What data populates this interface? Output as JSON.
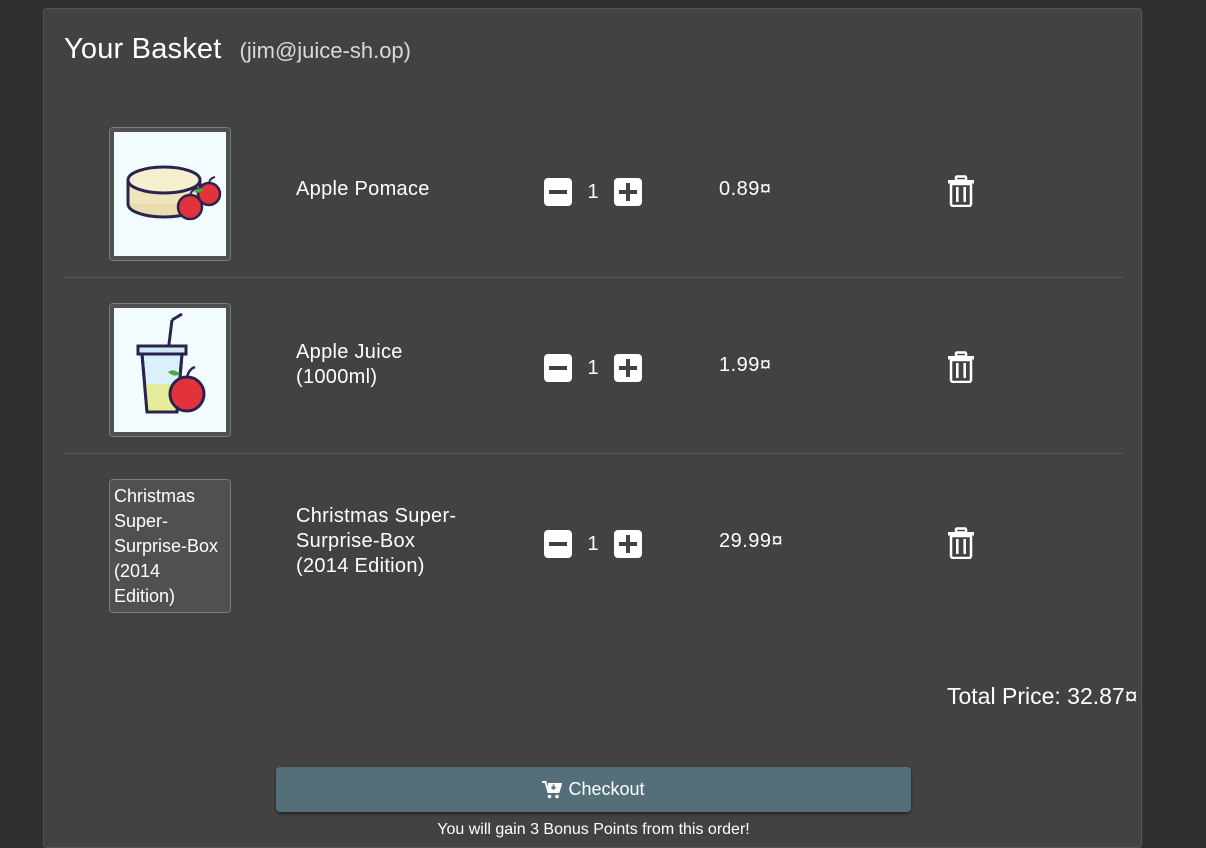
{
  "basket": {
    "title": "Your Basket",
    "user": "(jim@juice-sh.op)"
  },
  "items": [
    {
      "name": "Apple Pomace",
      "quantity": "1",
      "price": "0.89¤",
      "image": "apple-pomace-image"
    },
    {
      "name": "Apple Juice\n(1000ml)",
      "quantity": "1",
      "price": "1.99¤",
      "image": "apple-juice-image"
    },
    {
      "name": "Christmas Super-\nSurprise-Box\n(2014 Edition)",
      "quantity": "1",
      "price": "29.99¤",
      "image_alt": "Christmas Super-Surprise-Box (2014 Edition)"
    }
  ],
  "total": "Total Price: 32.87¤",
  "checkout": {
    "label": "Checkout",
    "icon": "cart-arrow-down-icon"
  },
  "bonus": "You will gain 3 Bonus Points from this order!",
  "colors": {
    "background": "#303030",
    "card": "#424242",
    "checkout": "#546e7a"
  }
}
